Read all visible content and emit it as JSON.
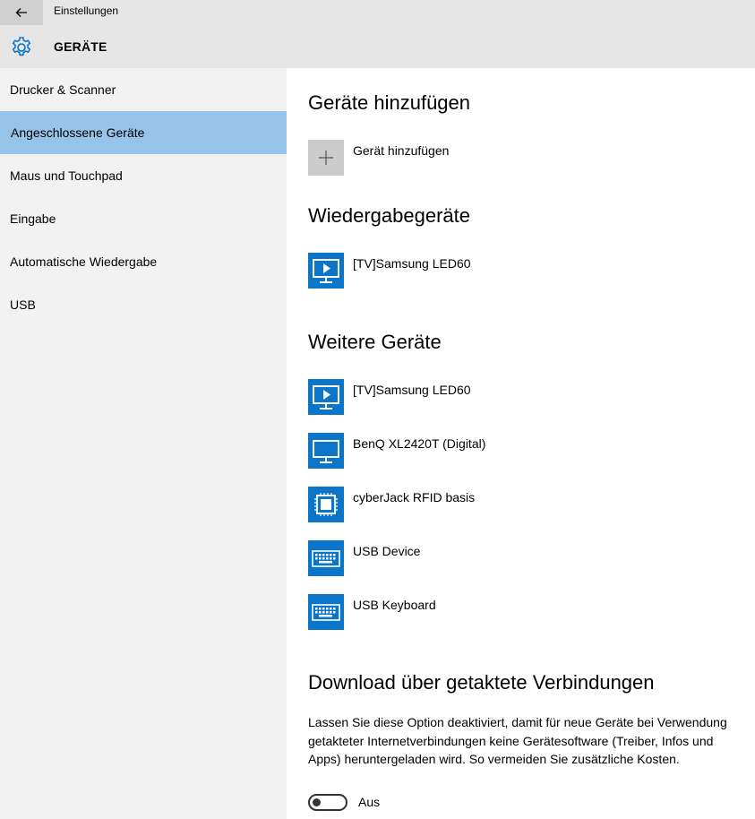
{
  "window": {
    "app_title": "Einstellungen",
    "section_title": "GERÄTE"
  },
  "sidebar": {
    "items": [
      {
        "label": "Drucker & Scanner"
      },
      {
        "label": "Angeschlossene Geräte",
        "selected": true
      },
      {
        "label": "Maus und Touchpad"
      },
      {
        "label": "Eingabe"
      },
      {
        "label": "Automatische Wiedergabe"
      },
      {
        "label": "USB"
      }
    ]
  },
  "main": {
    "add_section": {
      "heading": "Geräte hinzufügen",
      "add_label": "Gerät hinzufügen",
      "icon": "plus-icon"
    },
    "playback_section": {
      "heading": "Wiedergabegeräte",
      "devices": [
        {
          "name": "[TV]Samsung LED60",
          "icon": "tv-play-icon"
        }
      ]
    },
    "other_section": {
      "heading": "Weitere Geräte",
      "devices": [
        {
          "name": "[TV]Samsung LED60",
          "icon": "tv-play-icon"
        },
        {
          "name": "BenQ XL2420T (Digital)",
          "icon": "monitor-icon"
        },
        {
          "name": "cyberJack RFID basis",
          "icon": "chip-icon"
        },
        {
          "name": "USB Device",
          "icon": "keyboard-icon"
        },
        {
          "name": "USB Keyboard",
          "icon": "keyboard-icon"
        }
      ]
    },
    "metered_section": {
      "heading": "Download über getaktete Verbindungen",
      "description": "Lassen Sie diese Option deaktiviert, damit für neue Geräte bei Verwendung getakteter Internetverbindungen keine Gerätesoftware (Treiber, Infos und Apps) heruntergeladen wird. So vermeiden Sie zusätzliche Kosten.",
      "toggle": {
        "state": "off",
        "label": "Aus"
      }
    }
  },
  "colors": {
    "accent": "#0a75c9",
    "selected_nav": "#98c3e8",
    "sidebar_bg": "#f2f2f2",
    "titlebar_bg": "#e6e6e6"
  }
}
